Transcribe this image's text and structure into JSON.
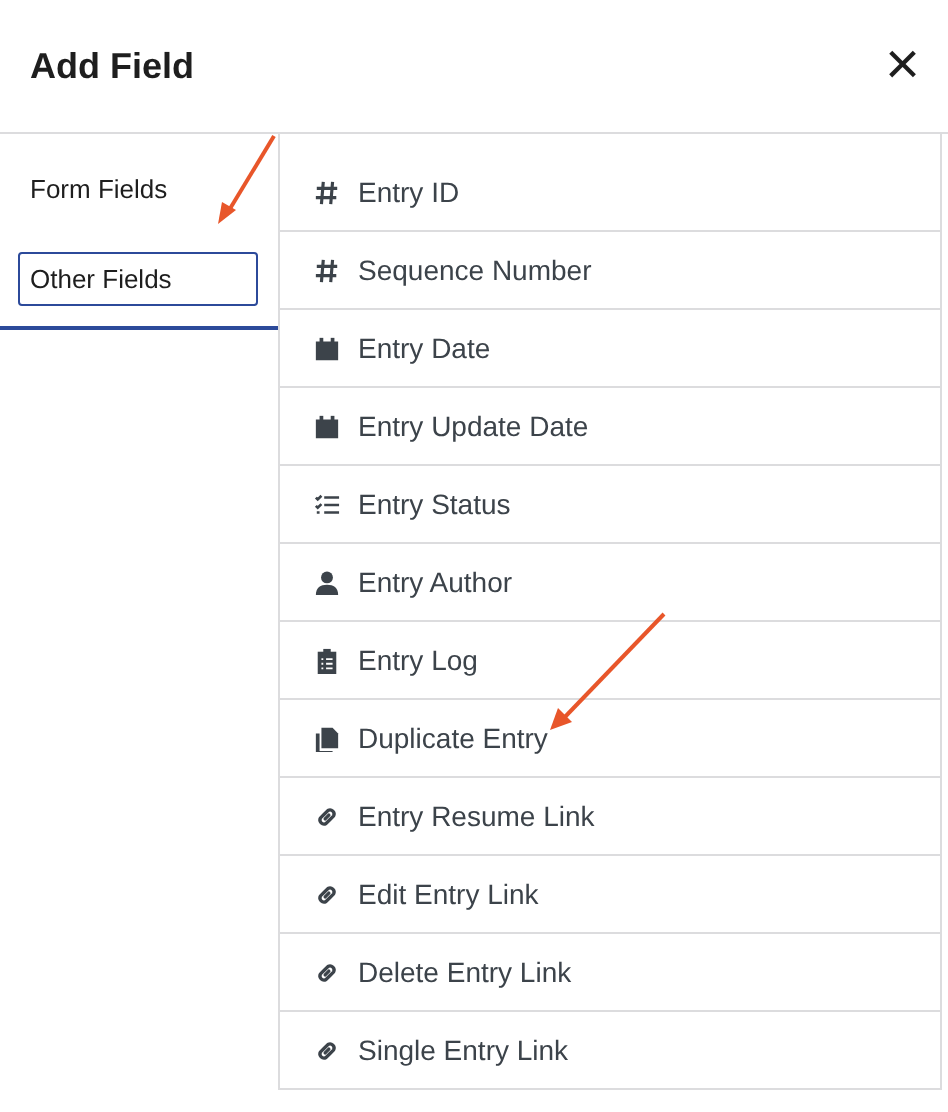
{
  "dialog": {
    "title": "Add Field",
    "close": "×"
  },
  "tabs": [
    {
      "label": "Form Fields",
      "selected": false
    },
    {
      "label": "Other Fields",
      "selected": true
    }
  ],
  "fields": [
    {
      "label": "Entry ID",
      "kind": "hash"
    },
    {
      "label": "Sequence Number",
      "kind": "hash"
    },
    {
      "label": "Entry Date",
      "kind": "calendar"
    },
    {
      "label": "Entry Update Date",
      "kind": "calendar"
    },
    {
      "label": "Entry Status",
      "kind": "checklist"
    },
    {
      "label": "Entry Author",
      "kind": "user"
    },
    {
      "label": "Entry Log",
      "kind": "clipboard"
    },
    {
      "label": "Duplicate Entry",
      "kind": "copy"
    },
    {
      "label": "Entry Resume Link",
      "kind": "link"
    },
    {
      "label": "Edit Entry Link",
      "kind": "link"
    },
    {
      "label": "Delete Entry Link",
      "kind": "link"
    },
    {
      "label": "Single Entry Link",
      "kind": "link"
    }
  ]
}
